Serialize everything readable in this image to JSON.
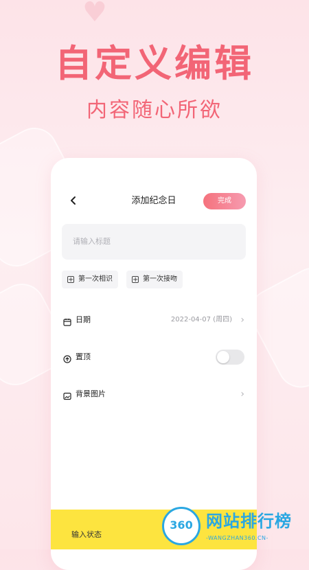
{
  "hero": {
    "title": "自定义编辑",
    "subtitle": "内容随心所欲"
  },
  "nav": {
    "back_icon": "chevron-left-icon",
    "title": "添加纪念日",
    "done_label": "完成"
  },
  "form": {
    "title_placeholder": "请输入标题",
    "chips": [
      {
        "label": "第一次相识"
      },
      {
        "label": "第一次接吻"
      }
    ],
    "rows": {
      "date": {
        "label": "日期",
        "value": "2022-04-07 (周四)"
      },
      "pin": {
        "label": "置顶",
        "toggle_on": false
      },
      "background": {
        "label": "背景图片"
      }
    },
    "input_status_label": "输入状态"
  },
  "watermark": {
    "badge": "360",
    "name": "网站排行榜",
    "url": "-WANGZHAN360.CN-"
  },
  "colors": {
    "accent": "#f26576",
    "button_gradient_start": "#f5727d",
    "button_gradient_end": "#f69bb0",
    "yellow": "#fde43f",
    "watermark_blue": "#2aa7e2"
  }
}
